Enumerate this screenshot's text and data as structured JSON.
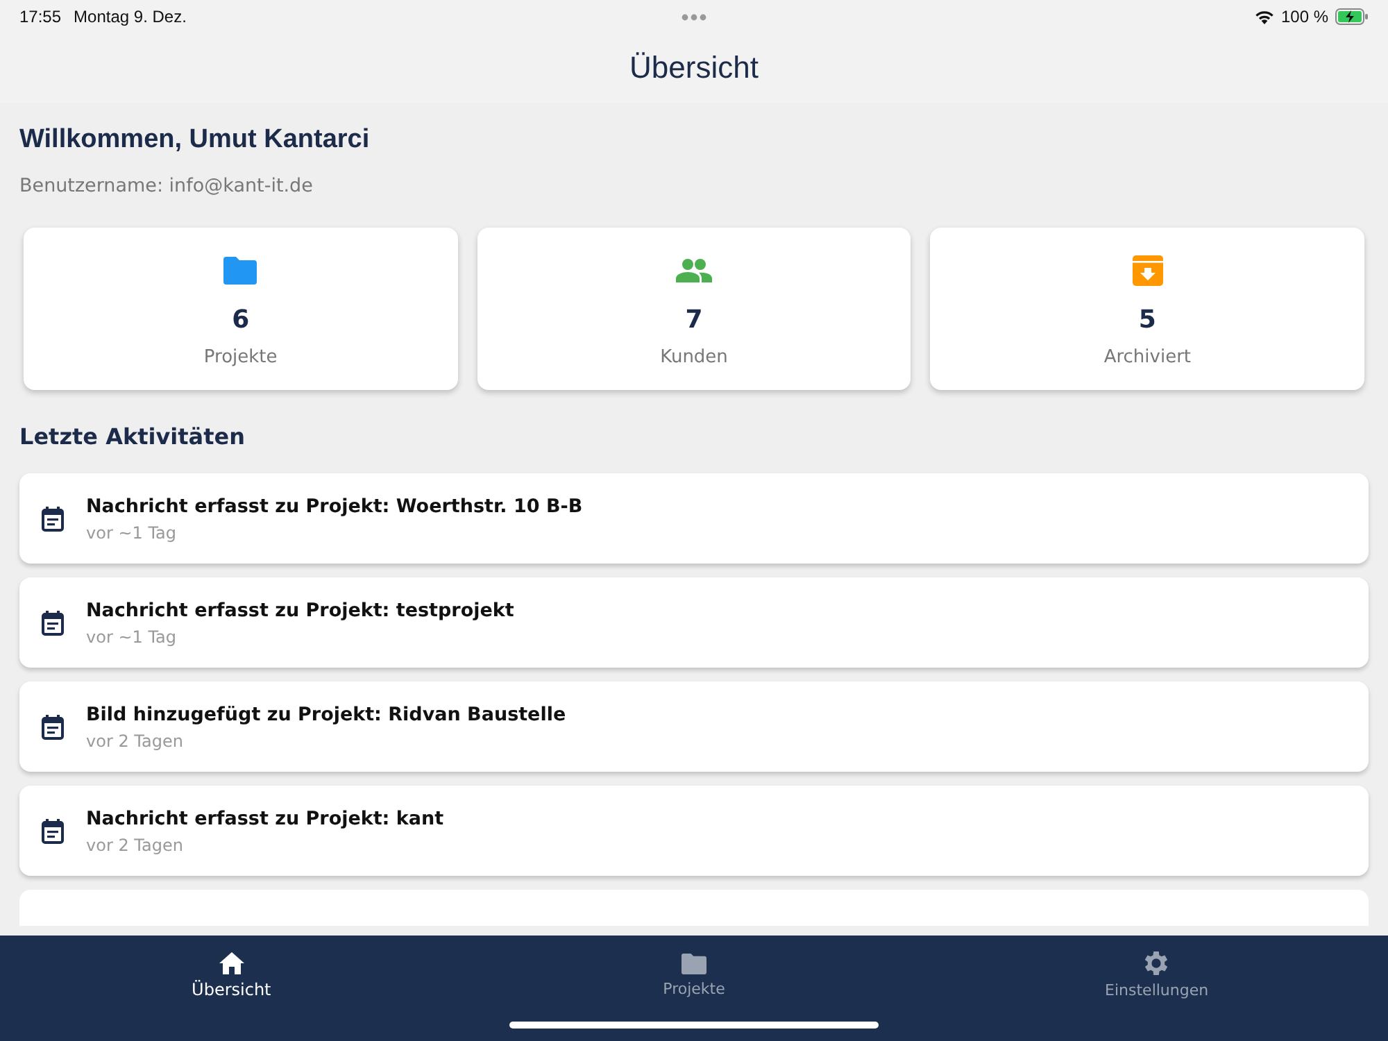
{
  "status_bar": {
    "time": "17:55",
    "date": "Montag 9. Dez.",
    "battery": "100 %"
  },
  "header": {
    "title": "Übersicht"
  },
  "welcome": {
    "title": "Willkommen, Umut Kantarci",
    "username": "Benutzername: info@kant-it.de"
  },
  "stats": [
    {
      "kind": "folder",
      "value": "6",
      "label": "Projekte",
      "color": "#2196f3"
    },
    {
      "kind": "people",
      "value": "7",
      "label": "Kunden",
      "color": "#4caf50"
    },
    {
      "kind": "archive",
      "value": "5",
      "label": "Archiviert",
      "color": "#ff9800"
    }
  ],
  "activities_heading": "Letzte Aktivitäten",
  "activities": [
    {
      "title": "Nachricht erfasst zu Projekt: Woerthstr. 10 B-B",
      "time": "vor ~1 Tag"
    },
    {
      "title": "Nachricht erfasst zu Projekt: testprojekt",
      "time": "vor ~1 Tag"
    },
    {
      "title": "Bild hinzugefügt zu Projekt: Ridvan Baustelle",
      "time": "vor 2 Tagen"
    },
    {
      "title": "Nachricht erfasst zu Projekt: kant",
      "time": "vor 2 Tagen"
    }
  ],
  "activities_continue": true,
  "tab_bar": [
    {
      "kind": "home",
      "label": "Übersicht",
      "selected": true
    },
    {
      "kind": "folder",
      "label": "Projekte",
      "selected": false
    },
    {
      "kind": "gear",
      "label": "Einstellungen",
      "selected": false
    }
  ]
}
